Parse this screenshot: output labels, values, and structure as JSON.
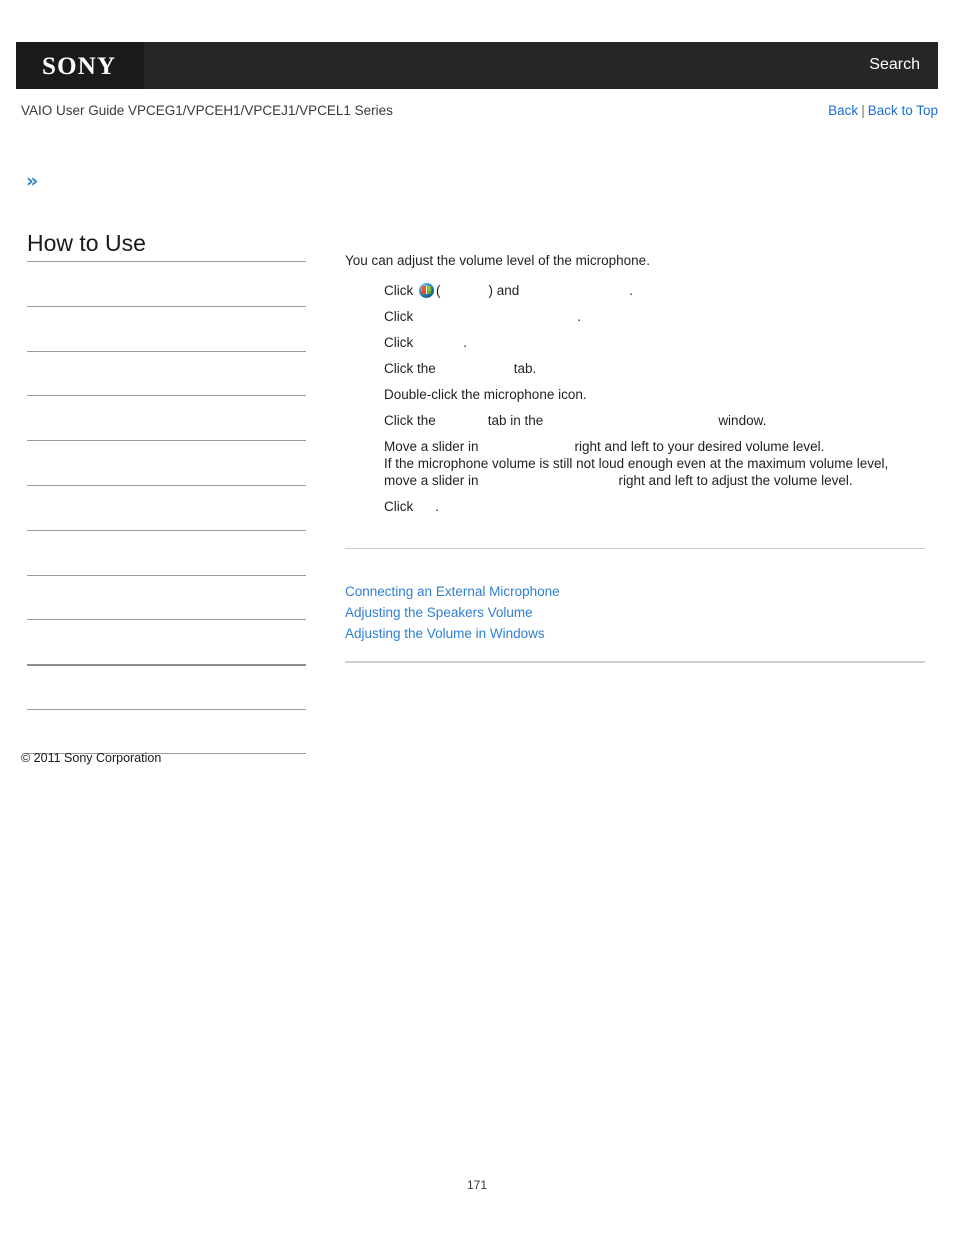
{
  "header": {
    "logo": "SONY",
    "search_label": "Search"
  },
  "subheader": {
    "title": "VAIO User Guide VPCEG1/VPCEH1/VPCEJ1/VPCEL1 Series",
    "back_label": "Back",
    "separator": "|",
    "back_to_top_label": "Back to Top"
  },
  "sidebar": {
    "expand_icon": "»",
    "title": "How to Use",
    "items": [
      {
        "label": ""
      },
      {
        "label": ""
      },
      {
        "label": ""
      },
      {
        "label": ""
      },
      {
        "label": ""
      },
      {
        "label": ""
      },
      {
        "label": ""
      },
      {
        "label": ""
      },
      {
        "label": ""
      },
      {
        "label": ""
      },
      {
        "label": ""
      },
      {
        "label": ""
      }
    ],
    "copyright": "© 2011 Sony Corporation"
  },
  "main": {
    "intro": "You can adjust the volume level of the microphone.",
    "steps": [
      {
        "pre": "Click",
        "icon": "windows-start-orb",
        "mid": "(",
        "gap1": "",
        "post": ") and",
        "gap2": "",
        "end": "."
      },
      {
        "pre": "Click",
        "gap1": "",
        "end": "."
      },
      {
        "pre": "Click",
        "gap1": "",
        "end": "."
      },
      {
        "pre": "Click the",
        "gap1": "",
        "end": "tab."
      },
      {
        "pre": "Double-click the microphone icon.",
        "end": ""
      },
      {
        "pre": "Click the",
        "gap1": "",
        "mid": "tab in the",
        "gap2": "",
        "end": "window."
      },
      {
        "pre": "Move a slider in",
        "gap1": "",
        "end": "right and left to your desired volume level.",
        "line2a": "If the microphone volume is still not loud enough even at the maximum volume level,",
        "line2b": "move a slider in",
        "line2c": "right and left to adjust the volume level."
      },
      {
        "pre": "Click",
        "gap1": "",
        "end": "."
      }
    ]
  },
  "related_topics": [
    {
      "label": "Connecting an External Microphone"
    },
    {
      "label": "Adjusting the Speakers Volume"
    },
    {
      "label": "Adjusting the Volume in Windows"
    }
  ],
  "footer": {
    "page_number": "171"
  },
  "colors": {
    "header_bg": "#262626",
    "logo_block_bg": "#1a1a1a",
    "link_blue": "#2f7fd4",
    "nav_link_blue": "#1a6fd4",
    "rule_gray": "#c9cdd0",
    "sidebar_rule": "#9a9a9a"
  }
}
